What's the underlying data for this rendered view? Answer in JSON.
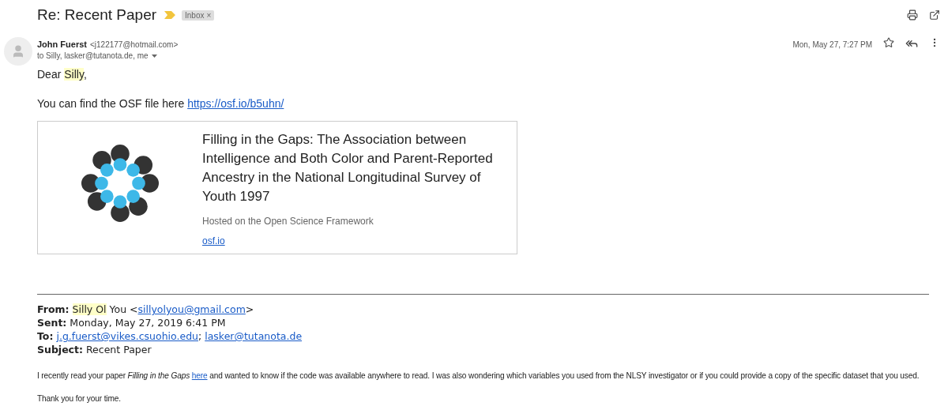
{
  "subject": "Re: Recent Paper",
  "label": {
    "text": "Inbox",
    "close": "×"
  },
  "message": {
    "sender_name": "John Fuerst",
    "sender_email": "<j122177@hotmail.com>",
    "recipients": "to Silly, lasker@tutanota.de, me",
    "date": "Mon, May 27, 7:27 PM",
    "starred": false
  },
  "greeting": [
    {
      "kind": "text",
      "text": "Dear "
    },
    {
      "kind": "highlight",
      "text": "Silly"
    },
    {
      "kind": "text",
      "text": ","
    }
  ],
  "intro": [
    {
      "kind": "text",
      "text": "You can find the OSF file here "
    },
    {
      "kind": "link",
      "text": "https://osf.io/b5uhn/"
    }
  ],
  "preview_card": {
    "title": "Filling in the Gaps: The Association between Intelligence and Both Color and Parent-Reported Ancestry in the National Longitudinal Survey of Youth 1997",
    "description": "Hosted on the Open Science Framework",
    "domain": "osf.io"
  },
  "quoted_header": [
    {
      "label": "From:",
      "parts": [
        {
          "kind": "highlight",
          "text": "Silly Ol"
        },
        {
          "kind": "text",
          "text": " You <"
        },
        {
          "kind": "link",
          "text": "sillyolyou@gmail.com"
        },
        {
          "kind": "text",
          "text": ">"
        }
      ]
    },
    {
      "label": "Sent:",
      "parts": [
        {
          "kind": "text",
          "text": "Monday, May 27, 2019 6:41 PM"
        }
      ]
    },
    {
      "label": "To:",
      "parts": [
        {
          "kind": "link",
          "text": "j.g.fuerst@vikes.csuohio.edu"
        },
        {
          "kind": "text",
          "text": "; "
        },
        {
          "kind": "link",
          "text": "lasker@tutanota.de"
        }
      ]
    },
    {
      "label": "Subject:",
      "parts": [
        {
          "kind": "text",
          "text": "Recent Paper"
        }
      ]
    }
  ],
  "quoted_body": [
    [
      {
        "kind": "text",
        "text": "I recently read your paper "
      },
      {
        "kind": "italic",
        "text": "Filling in the Gaps "
      },
      {
        "kind": "link",
        "text": "here"
      },
      {
        "kind": "text",
        "text": " and wanted to know if the code was available anywhere to read. I was also wondering which variables you used from the NLSY investigator or if you could provide a copy of the specific dataset that you used."
      }
    ],
    [
      {
        "kind": "text",
        "text": "Thank you for your time."
      }
    ]
  ]
}
